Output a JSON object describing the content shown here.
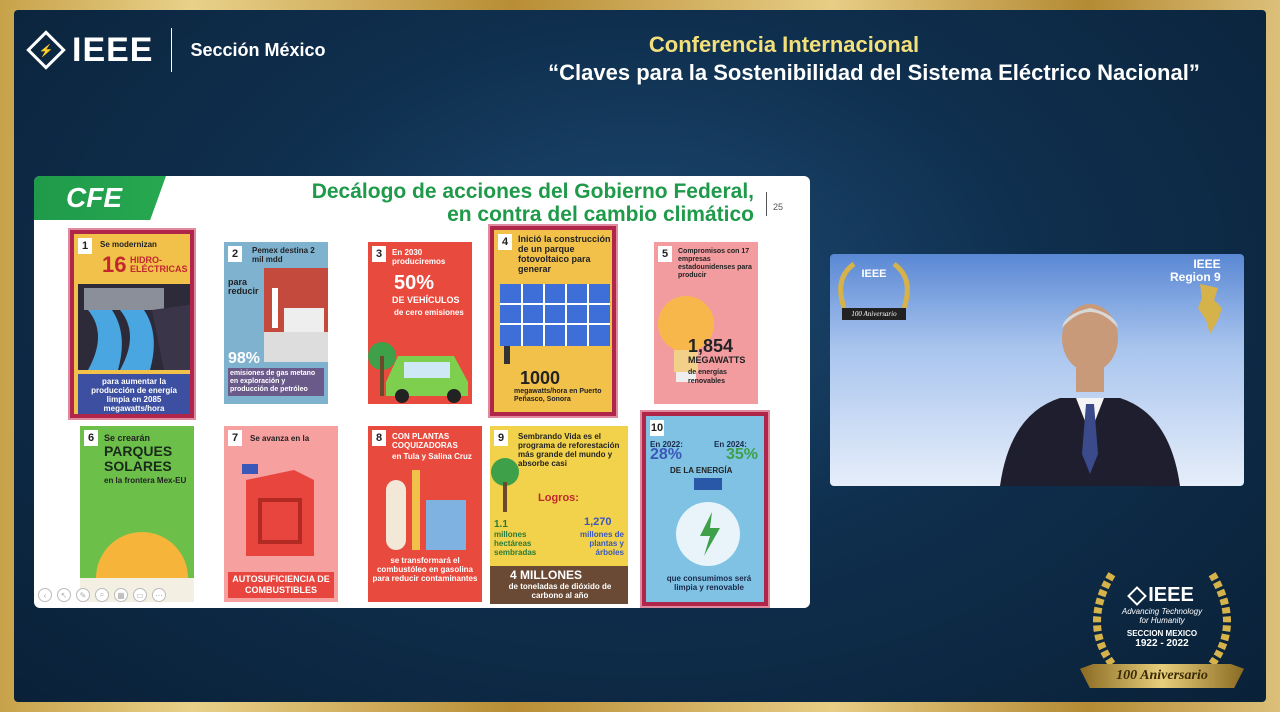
{
  "header": {
    "logo_text": "IEEE",
    "section": "Sección México",
    "conf_title": "Conferencia Internacional",
    "conf_subtitle": "“Claves para la Sostenibilidad del Sistema Eléctrico Nacional”"
  },
  "slide": {
    "brand": "CFE",
    "title_line1": "Decálogo de acciones del Gobierno Federal,",
    "title_line2": "en contra del cambio climático",
    "page_number": "25",
    "cards": [
      {
        "num": "1",
        "top": "Se modernizan",
        "big": "16",
        "big2": "HIDRO-ELÉCTRICAS",
        "bottom": "para aumentar la producción de energía limpia en 2085 megawatts/hora"
      },
      {
        "num": "2",
        "top": "Pemex destina 2 mil mdd",
        "mid": "para reducir",
        "big": "98%",
        "bottom": "emisiones de gas metano en exploración y producción de petróleo"
      },
      {
        "num": "3",
        "top": "En 2030 produciremos",
        "big": "50%",
        "big2": "DE VEHÍCULOS",
        "bottom": "de cero emisiones"
      },
      {
        "num": "4",
        "top": "Inició la construcción de un parque fotovoltaico para generar",
        "big": "1000",
        "bottom": "megawatts/hora en Puerto Peñasco, Sonora"
      },
      {
        "num": "5",
        "top": "Compromisos con 17 empresas estadounidenses para producir",
        "big": "1,854",
        "big2": "MEGAWATTS",
        "bottom": "de energías renovables"
      },
      {
        "num": "6",
        "top": "Se crearán",
        "big": "PARQUES SOLARES",
        "bottom": "en la frontera Mex-EU"
      },
      {
        "num": "7",
        "top": "Se avanza en la",
        "big": "AUTOSUFICIENCIA DE COMBUSTIBLES"
      },
      {
        "num": "8",
        "top": "CON PLANTAS COQUIZADORAS",
        "mid": "en Tula y Salina Cruz",
        "bottom": "se transformará el combustóleo en gasolina para reducir contaminantes"
      },
      {
        "num": "9",
        "top": "Sembrando Vida es el programa de reforestación más grande del mundo y absorbe casi",
        "logros": "Logros:",
        "stat1": "1.1",
        "stat1_label": "millones hectáreas sembradas",
        "stat2": "1,270",
        "stat2_label": "millones de plantas y árboles",
        "big": "4 MILLONES",
        "bottom": "de toneladas de dióxido de carbono al año"
      },
      {
        "num": "10",
        "y1": "En 2022:",
        "p1": "28%",
        "y2": "En 2024:",
        "p2": "35%",
        "mid": "DE LA ENERGÍA",
        "bottom": "que consumimos será limpia y renovable"
      }
    ]
  },
  "webcam": {
    "badge_text": "IEEE",
    "badge_ribbon": "100 Aniversario",
    "region_line1": "IEEE",
    "region_line2": "Region 9"
  },
  "anniversary": {
    "logo": "IEEE",
    "tagline1": "Advancing Technology",
    "tagline2": "for Humanity",
    "section": "SECCION MEXICO",
    "years": "1922 - 2022",
    "ribbon": "100 Aniversario"
  }
}
